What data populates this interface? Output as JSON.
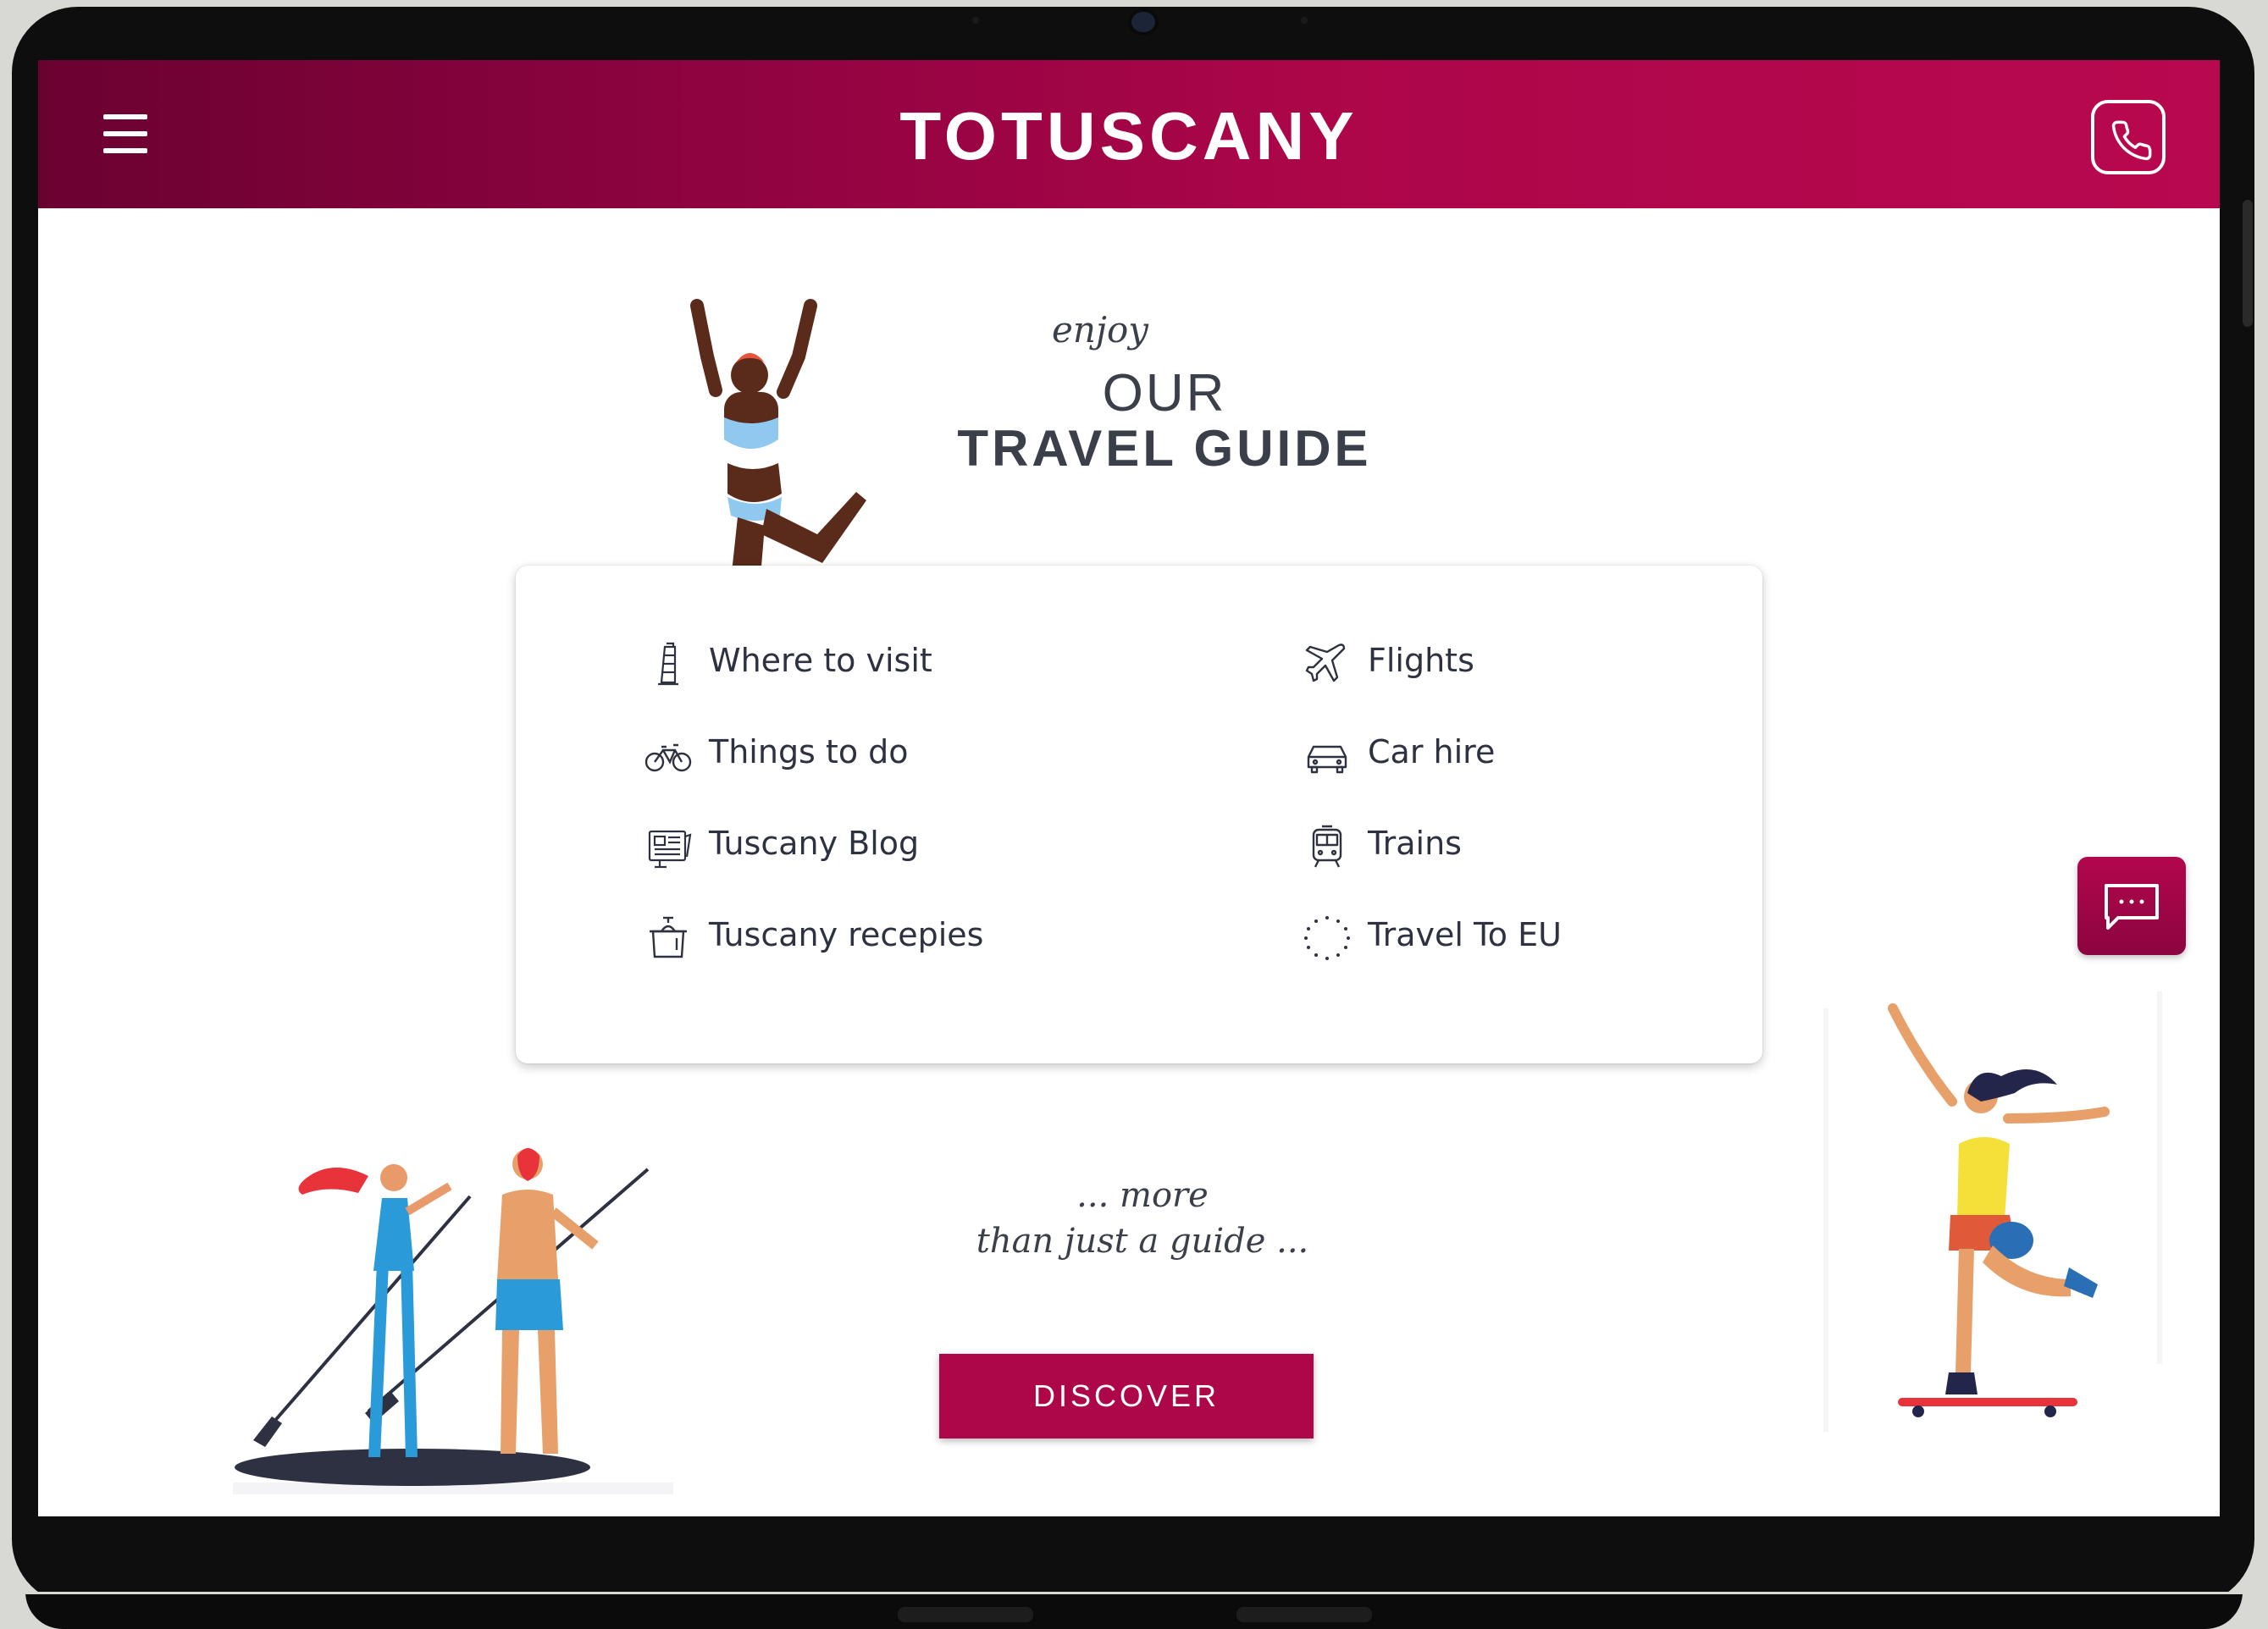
{
  "header": {
    "logo": "TOTUSCANY",
    "menu_icon": "hamburger-icon",
    "phone_icon": "phone-icon"
  },
  "hero": {
    "subtitle": "enjoy",
    "title_line1": "OUR",
    "title_line2": "TRAVEL GUIDE"
  },
  "guide_menu": {
    "left": [
      {
        "label": "Where to visit",
        "icon": "leaning-tower-icon"
      },
      {
        "label": "Things to do",
        "icon": "bicycle-icon"
      },
      {
        "label": "Tuscany Blog",
        "icon": "newspaper-icon"
      },
      {
        "label": "Tuscany recepies",
        "icon": "cooking-pot-icon"
      }
    ],
    "right": [
      {
        "label": "Flights",
        "icon": "airplane-icon"
      },
      {
        "label": "Car hire",
        "icon": "car-icon"
      },
      {
        "label": "Trains",
        "icon": "train-icon"
      },
      {
        "label": "Travel To EU",
        "icon": "eu-stars-icon"
      }
    ]
  },
  "tagline": {
    "line1": "... more",
    "line2": "than just a guide ..."
  },
  "cta": {
    "discover_label": "DISCOVER"
  },
  "chat": {
    "icon": "chat-bubble-icon"
  },
  "colors": {
    "brand": "#ad0649",
    "brand_dark": "#6a0230",
    "text": "#3b3f4a"
  }
}
